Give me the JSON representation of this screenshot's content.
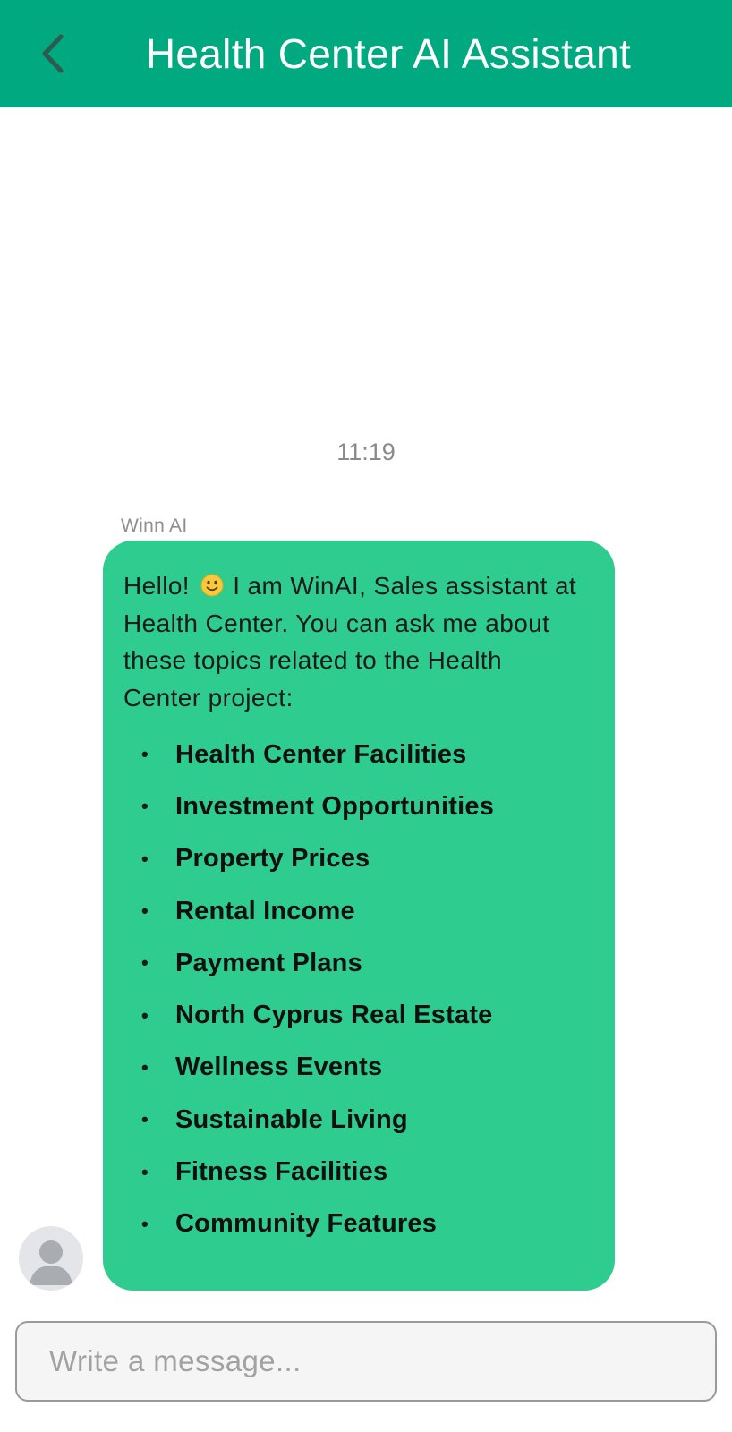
{
  "header": {
    "title": "Health Center AI Assistant",
    "back_icon": "chevron-left-icon",
    "background": "#00a97f"
  },
  "chat": {
    "timestamp": "11:19",
    "message": {
      "sender": "Winn AI",
      "intro_before_emoji": "Hello!",
      "emoji_icon": "slightly-smiling-face-icon",
      "intro_after_emoji": "I am WinAI, Sales assistant at Health Center. You can ask me about these topics related to the Health Center project:",
      "bubble_color": "#2ecc8f",
      "topics": [
        "Health Center Facilities",
        "Investment Opportunities",
        "Property Prices",
        "Rental Income",
        "Payment Plans",
        "North Cyprus Real Estate",
        "Wellness Events",
        "Sustainable Living",
        "Fitness Facilities",
        "Community Features"
      ]
    },
    "avatar_icon": "user-avatar-icon"
  },
  "composer": {
    "placeholder": "Write a message...",
    "value": ""
  }
}
